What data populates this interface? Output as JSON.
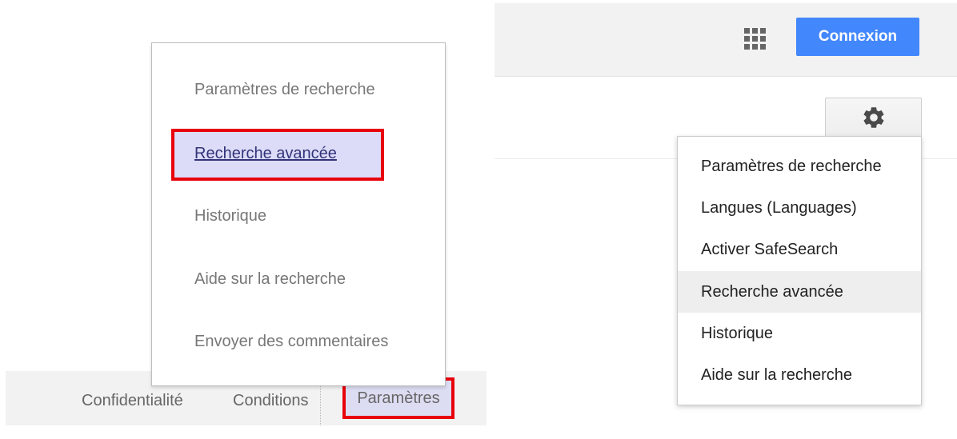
{
  "left_panel": {
    "footer": {
      "privacy_label": "Confidentialité",
      "terms_label": "Conditions",
      "settings_label": "Paramètres"
    },
    "menu": {
      "items": [
        {
          "label": "Paramètres de recherche"
        },
        {
          "label": "Recherche avancée",
          "highlighted": true
        },
        {
          "label": "Historique"
        },
        {
          "label": "Aide sur la recherche"
        },
        {
          "label": "Envoyer des commentaires"
        }
      ]
    },
    "highlight_color": "#e8000b"
  },
  "right_panel": {
    "header": {
      "apps_icon": "apps-grid-icon",
      "signin_label": "Connexion",
      "signin_color": "#4387fd"
    },
    "settings_icon": "gear-icon",
    "menu": {
      "items": [
        {
          "label": "Paramètres de recherche"
        },
        {
          "label": "Langues  (Languages)"
        },
        {
          "label": "Activer SafeSearch"
        },
        {
          "label": "Recherche avancée",
          "hovered": true
        },
        {
          "label": "Historique"
        },
        {
          "label": "Aide sur la recherche"
        }
      ]
    }
  }
}
